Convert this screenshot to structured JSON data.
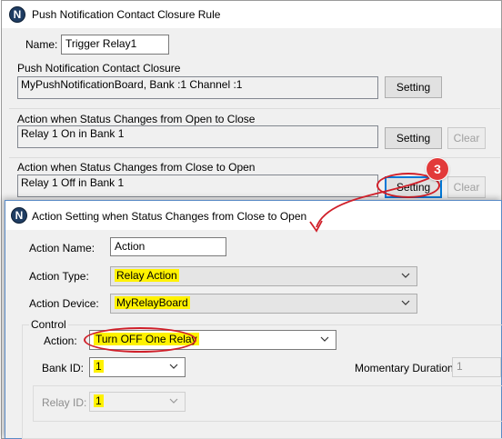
{
  "colors": {
    "annotation_red": "#d0202a",
    "highlight_yellow": "#fff200",
    "focus_blue": "#0078d7",
    "app_icon": "#1f3d63"
  },
  "back_window": {
    "icon": "app-n-icon",
    "title": "Push Notification Contact Closure Rule",
    "name_label": "Name:",
    "name_value": "Trigger Relay1",
    "group1": {
      "label": "Push Notification Contact Closure",
      "value": "MyPushNotificationBoard, Bank :1 Channel :1",
      "setting_label": "Setting"
    },
    "group2": {
      "label": "Action when Status Changes from Open to Close",
      "value": "Relay 1 On in Bank 1",
      "setting_label": "Setting",
      "clear_label": "Clear"
    },
    "group3": {
      "label": "Action when Status Changes from Close to Open",
      "value": "Relay 1 Off in Bank 1",
      "setting_label": "Setting",
      "clear_label": "Clear"
    },
    "step_badge": "3"
  },
  "front_window": {
    "icon": "app-n-icon",
    "title": "Action Setting when Status Changes from Close to Open",
    "action_name_label": "Action Name:",
    "action_name_value": "Action",
    "action_type_label": "Action Type:",
    "action_type_value": "Relay Action",
    "action_device_label": "Action Device:",
    "action_device_value": "MyRelayBoard",
    "control": {
      "legend": "Control",
      "action_label": "Action:",
      "action_value": "Turn OFF One Relay",
      "bank_id_label": "Bank ID:",
      "bank_id_value": "1",
      "momentary_label": "Momentary Duration:",
      "momentary_value": "1",
      "relay_id_label": "Relay ID:",
      "relay_id_value": "1"
    }
  }
}
